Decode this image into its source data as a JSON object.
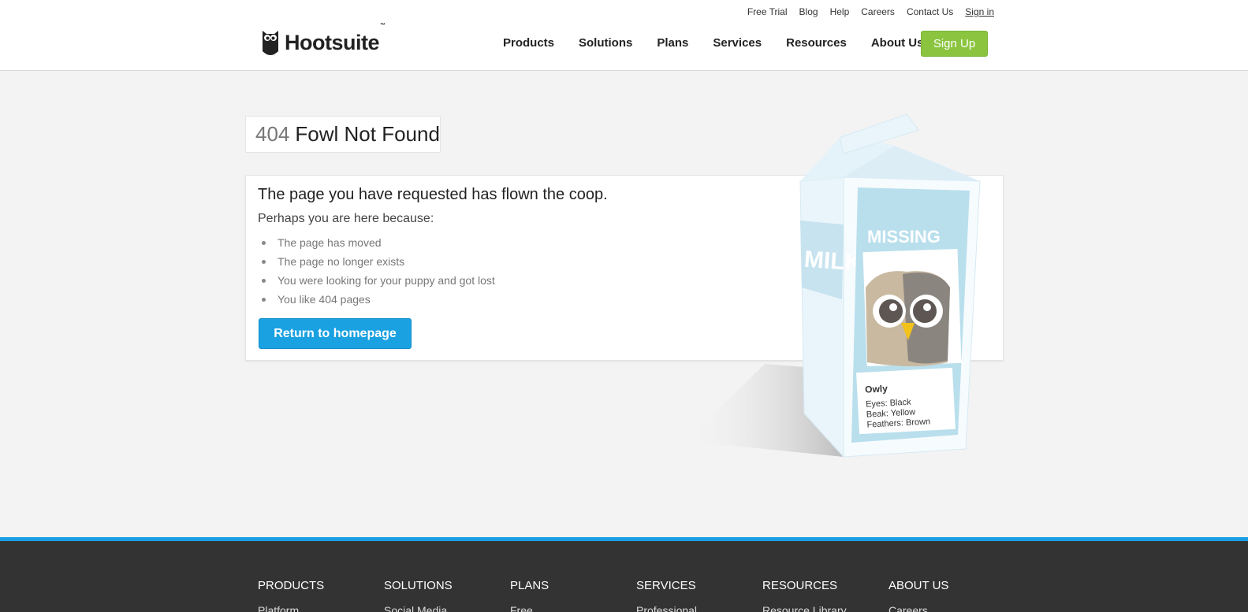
{
  "header": {
    "logo_text": "Hootsuite",
    "logo_tm": "™",
    "util_links": [
      "Free Trial",
      "Blog",
      "Help",
      "Careers",
      "Contact Us"
    ],
    "signin_label": "Sign in",
    "main_nav": [
      "Products",
      "Solutions",
      "Plans",
      "Services",
      "Resources",
      "About Us"
    ],
    "signup_label": "Sign Up",
    "colors": {
      "signup": "#8bc53f"
    }
  },
  "error": {
    "code": "404",
    "title": "Fowl Not Found",
    "heading": "The page you have requested has flown the coop.",
    "perhaps": "Perhaps you are here because:",
    "reasons": [
      "The page has moved",
      "The page no longer exists",
      "You were looking for your puppy and got lost",
      "You like 404 pages"
    ],
    "return_label": "Return to homepage",
    "colors": {
      "return_button": "#1aa1e1"
    }
  },
  "carton": {
    "side_text": "MILK",
    "missing_label": "MISSING",
    "name": "Owly",
    "eyes": "Eyes: Black",
    "beak": "Beak: Yellow",
    "feathers": "Feathers: Brown"
  },
  "footer": {
    "accent": "#1a9ee3",
    "columns": [
      {
        "heading": "PRODUCTS",
        "first_link": "Platform"
      },
      {
        "heading": "SOLUTIONS",
        "first_link": "Social Media"
      },
      {
        "heading": "PLANS",
        "first_link": "Free"
      },
      {
        "heading": "SERVICES",
        "first_link": "Professional"
      },
      {
        "heading": "RESOURCES",
        "first_link": "Resource Library"
      },
      {
        "heading": "ABOUT US",
        "first_link": "Careers"
      }
    ]
  }
}
